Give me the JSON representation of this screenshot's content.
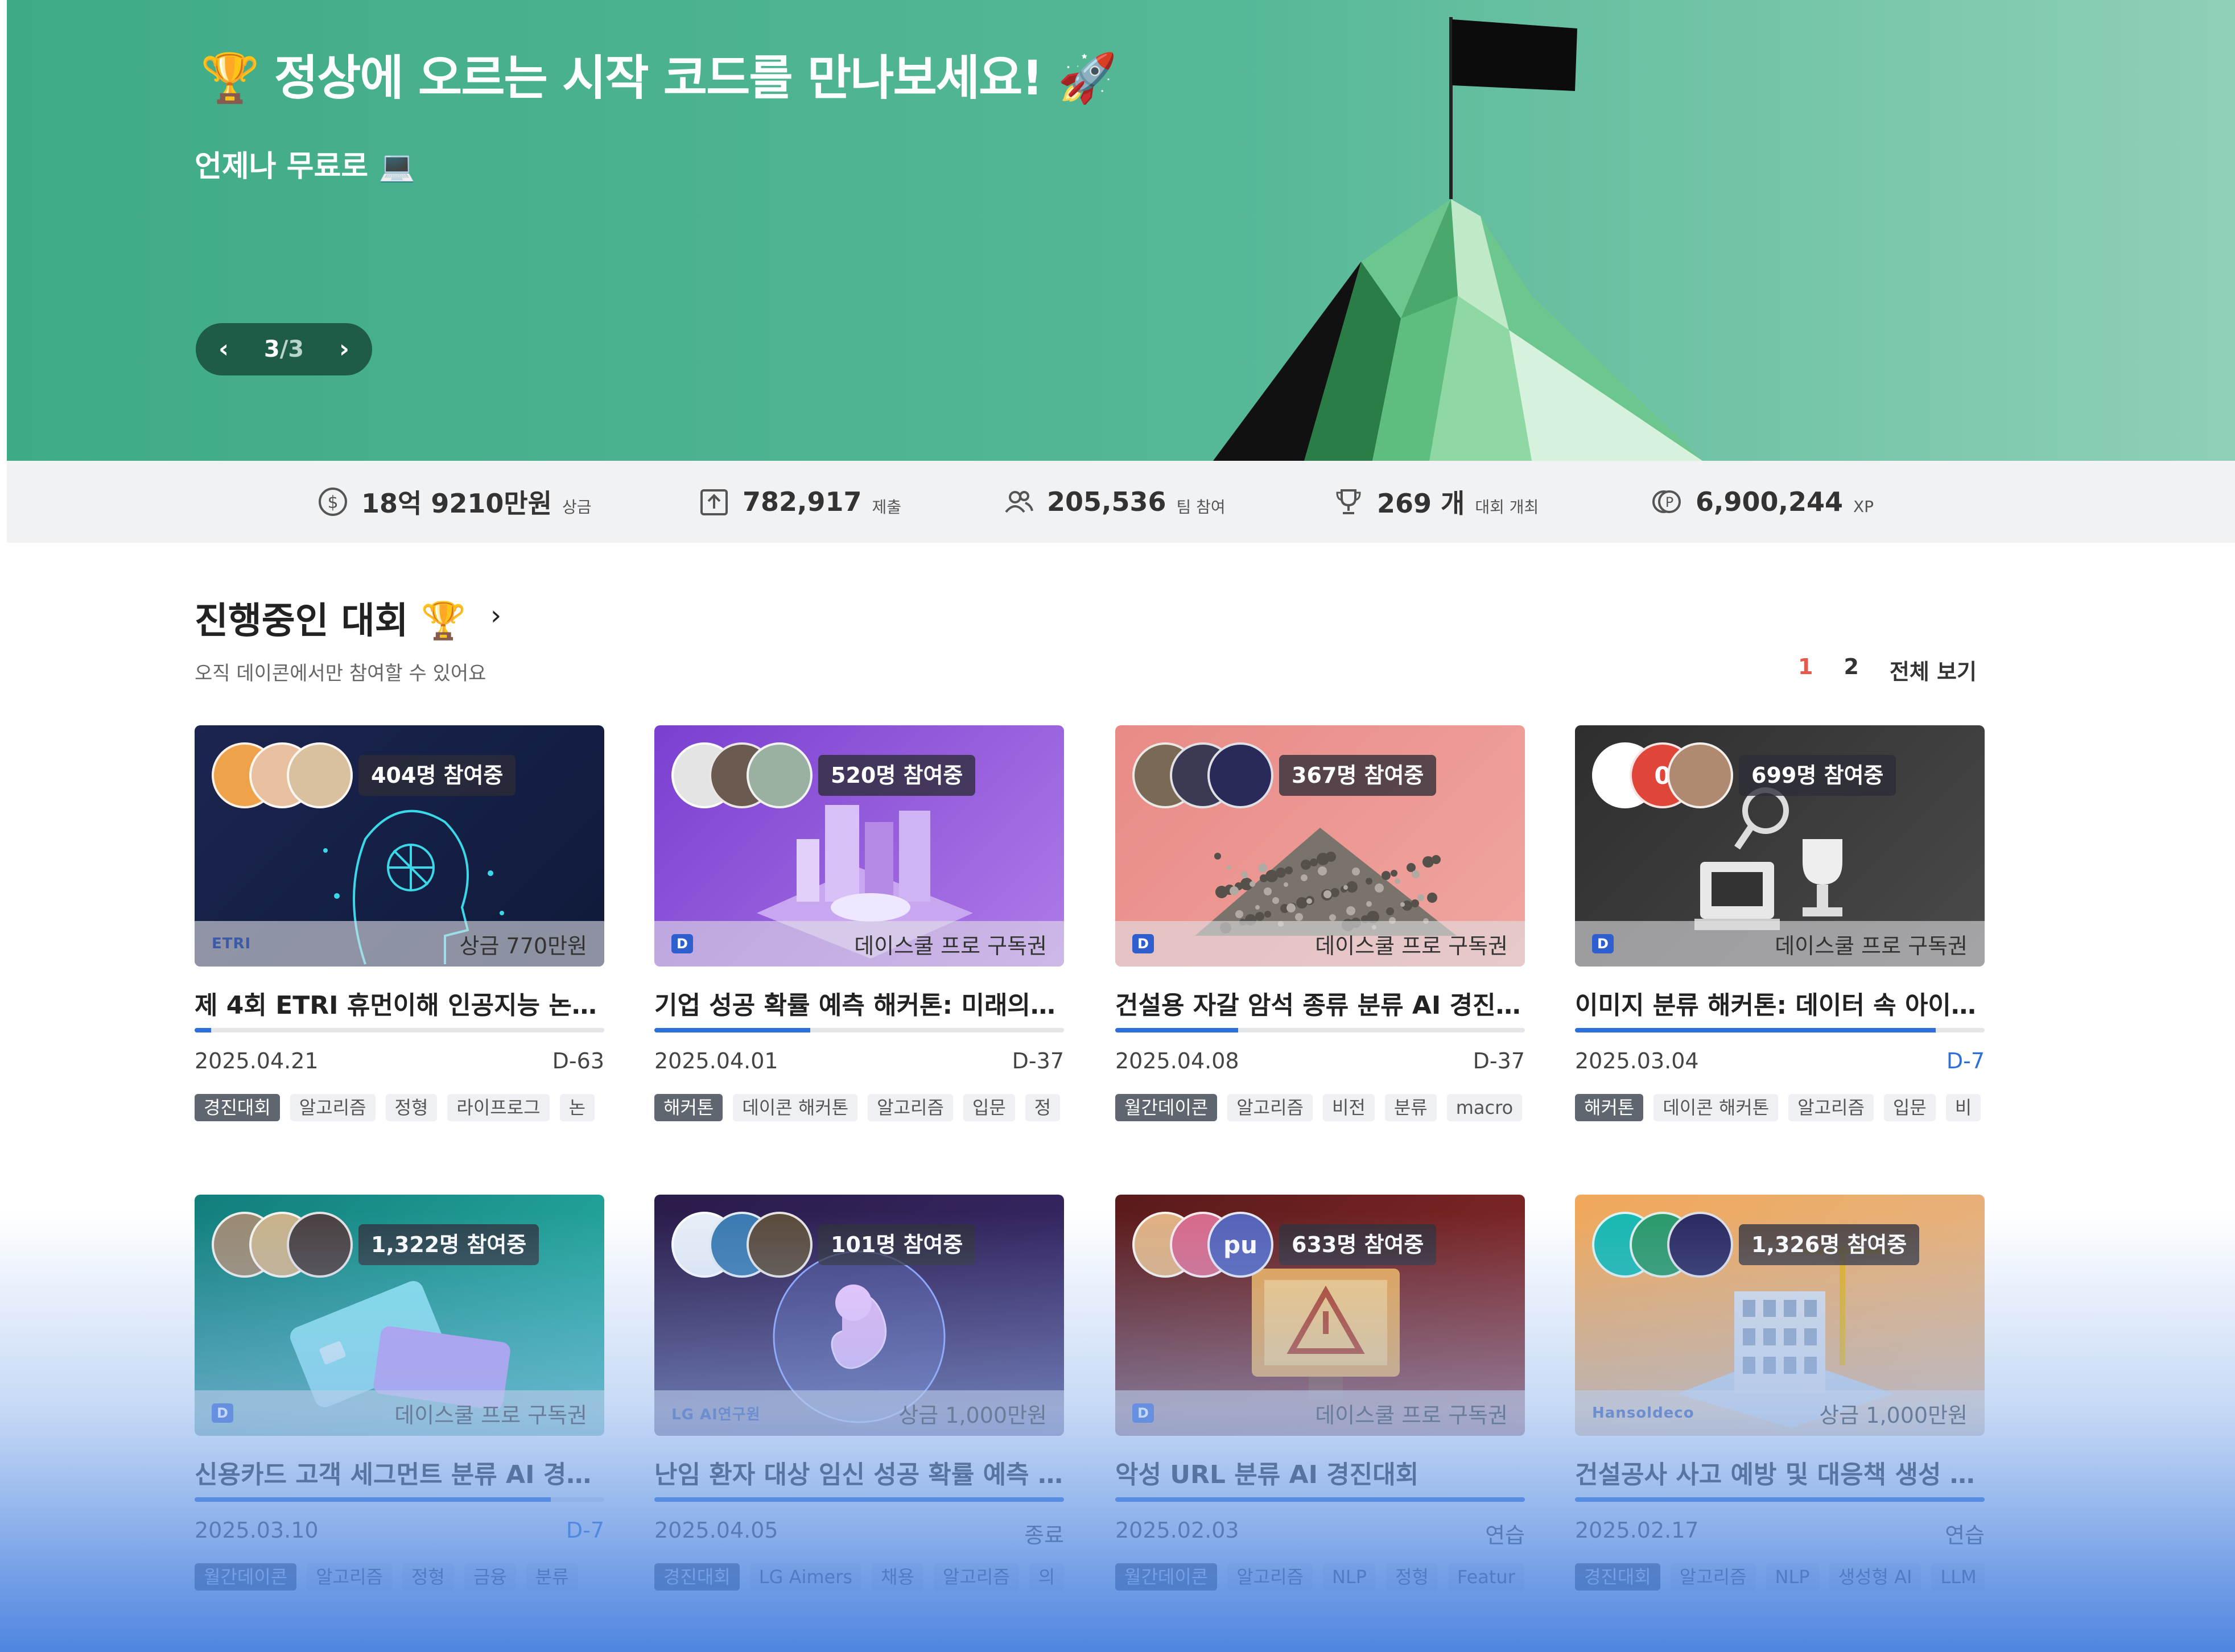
{
  "hero": {
    "title": "🏆 정상에 오르는 시작 코드를 만나보세요! 🚀",
    "subtitle": "언제나 무료로 💻",
    "pager": {
      "current": "3",
      "total": "/3",
      "prev": "‹",
      "next": "›"
    }
  },
  "stats": [
    {
      "icon": "dollar-coin-icon",
      "value": "18억 9210만원",
      "unit": "상금"
    },
    {
      "icon": "upload-icon",
      "value": "782,917",
      "unit": "제출"
    },
    {
      "icon": "users-icon",
      "value": "205,536",
      "unit": "팀 참여"
    },
    {
      "icon": "trophy-icon",
      "value": "269 개",
      "unit": "대회 개최"
    },
    {
      "icon": "point-coin-icon",
      "value": "6,900,244",
      "unit": "XP"
    }
  ],
  "section": {
    "title": "진행중인 대회 🏆",
    "more": "›",
    "subtitle": "오직 데이콘에서만 참여할 수 있어요",
    "pages": [
      "1",
      "2"
    ],
    "view_all": "전체 보기"
  },
  "cards": [
    {
      "participants": "404명 참여중",
      "band_logo": "ETRI",
      "band_text": "상금 770만원",
      "title": "제 4회 ETRI 휴먼이해 인공지능 논문...",
      "date": "2025.04.21",
      "dday": "D-63",
      "progress": 0.04,
      "tags": [
        "경진대회",
        "알고리즘",
        "정형",
        "라이프로그",
        "논"
      ],
      "theme": "navy",
      "avatar_labels": [
        "",
        "",
        ""
      ]
    },
    {
      "participants": "520명 참여중",
      "band_logo": "D",
      "band_text": "데이스쿨 프로 구독권",
      "title": "기업 성공 확률 예측 해커톤: 미래의 성...",
      "date": "2025.04.01",
      "dday": "D-37",
      "progress": 0.38,
      "tags": [
        "해커톤",
        "데이콘 해커톤",
        "알고리즘",
        "입문",
        "정"
      ],
      "theme": "purple",
      "avatar_labels": [
        "",
        "",
        ""
      ]
    },
    {
      "participants": "367명 참여중",
      "band_logo": "D",
      "band_text": "데이스쿨 프로 구독권",
      "title": "건설용 자갈 암석 종류 분류 AI 경진대회",
      "date": "2025.04.08",
      "dday": "D-37",
      "progress": 0.3,
      "tags": [
        "월간데이콘",
        "알고리즘",
        "비전",
        "분류",
        "macro"
      ],
      "theme": "salmon",
      "avatar_labels": [
        "",
        "",
        ""
      ]
    },
    {
      "participants": "699명 참여중",
      "band_logo": "D",
      "band_text": "데이스쿨 프로 구독권",
      "title": "이미지 분류 해커톤: 데이터 속 아이콘...",
      "date": "2025.03.04",
      "dday": "D-7",
      "progress": 0.88,
      "tags": [
        "해커톤",
        "데이콘 해커톤",
        "알고리즘",
        "입문",
        "비"
      ],
      "theme": "dark",
      "avatar_labels": [
        "",
        "0",
        ""
      ]
    },
    {
      "participants": "1,322명 참여중",
      "band_logo": "D",
      "band_text": "데이스쿨 프로 구독권",
      "title": "신용카드 고객 세그먼트 분류 AI 경진...",
      "date": "2025.03.10",
      "dday": "D-7",
      "progress": 0.87,
      "tags": [
        "월간데이콘",
        "알고리즘",
        "정형",
        "금융",
        "분류"
      ],
      "theme": "teal",
      "avatar_labels": [
        "",
        "",
        ""
      ]
    },
    {
      "participants": "101명 참여중",
      "band_logo": "LG AI연구원",
      "band_text": "상금 1,000만원",
      "title": "난임 환자 대상 임신 성공 확률 예측 AI...",
      "date": "2025.04.05",
      "dday": "종료",
      "progress": 1.0,
      "tags": [
        "경진대회",
        "LG Aimers",
        "채용",
        "알고리즘",
        "의"
      ],
      "theme": "space",
      "avatar_labels": [
        "",
        "",
        ""
      ]
    },
    {
      "participants": "633명 참여중",
      "band_logo": "D",
      "band_text": "데이스쿨 프로 구독권",
      "title": "악성 URL 분류 AI 경진대회",
      "date": "2025.02.03",
      "dday": "연습",
      "progress": 1.0,
      "tags": [
        "월간데이콘",
        "알고리즘",
        "NLP",
        "정형",
        "Featur"
      ],
      "theme": "danger",
      "avatar_labels": [
        "",
        "",
        "pu"
      ]
    },
    {
      "participants": "1,326명 참여중",
      "band_logo": "Hansoldeco",
      "band_text": "상금 1,000만원",
      "title": "건설공사 사고 예방 및 대응책 생성 : ...",
      "date": "2025.02.17",
      "dday": "연습",
      "progress": 1.0,
      "tags": [
        "경진대회",
        "알고리즘",
        "NLP",
        "생성형 AI",
        "LLM"
      ],
      "theme": "orange",
      "avatar_labels": [
        "",
        "",
        ""
      ]
    }
  ],
  "colors": {
    "hero_green": "#3fab86",
    "accent_red": "#e7584d",
    "accent_blue": "#2e6fd9",
    "stats_bg": "#f1f2f4"
  }
}
